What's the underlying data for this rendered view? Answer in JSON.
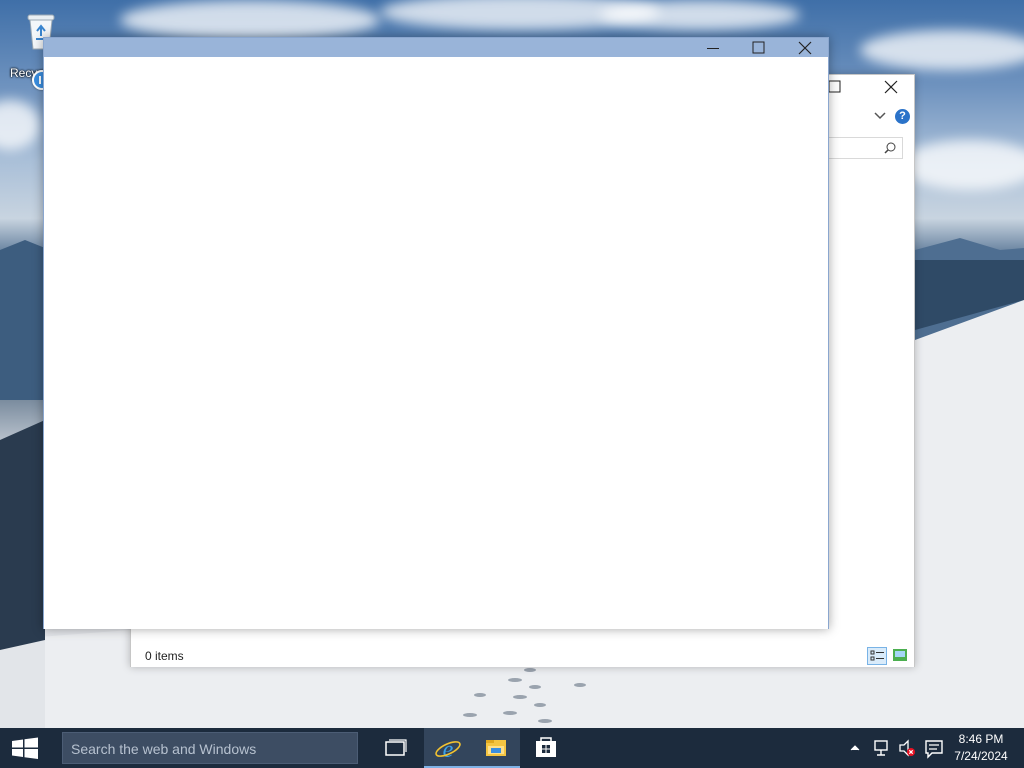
{
  "desktop": {
    "recycle_bin_label": "Recycle Bin"
  },
  "explorer_window": {
    "status_text": "0 items"
  },
  "foreground_window": {
    "title": ""
  },
  "taskbar": {
    "search_placeholder": "Search the web and Windows",
    "apps": [
      {
        "name": "Task View",
        "icon": "task-view-icon"
      },
      {
        "name": "Internet Explorer",
        "icon": "internet-explorer-icon"
      },
      {
        "name": "File Explorer",
        "icon": "file-explorer-icon"
      },
      {
        "name": "Store",
        "icon": "store-icon"
      }
    ],
    "clock_time": "8:46 PM",
    "clock_date": "7/24/2024"
  },
  "colors": {
    "taskbar": "#1c2b3d",
    "search_bar": "#3d4d63",
    "active_titlebar": "#99b4d9",
    "accent": "#7fb2e6"
  }
}
